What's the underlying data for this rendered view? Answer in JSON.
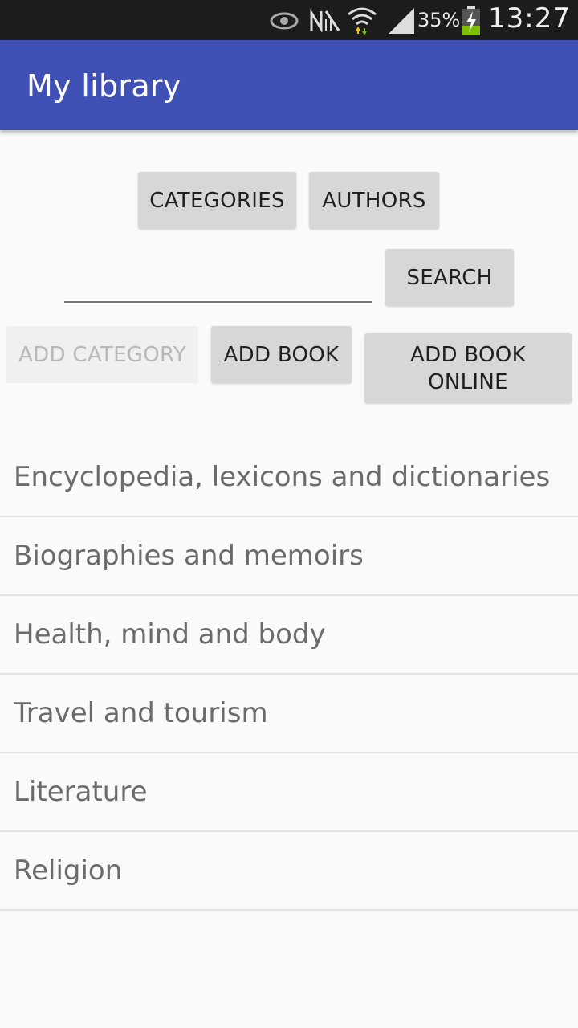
{
  "status_bar": {
    "battery_percent": "35%",
    "time": "13:27",
    "icons": [
      "eye-icon",
      "no-sim-icon",
      "wifi-icon",
      "signal-icon",
      "battery-charging-icon"
    ]
  },
  "app_bar": {
    "title": "My library",
    "color": "#3f51b5"
  },
  "buttons": {
    "categories": "CATEGORIES",
    "authors": "AUTHORS",
    "search": "SEARCH",
    "add_category": "ADD CATEGORY",
    "add_book": "ADD BOOK",
    "add_book_online_line1": "ADD BOOK",
    "add_book_online_line2": "ONLINE"
  },
  "search": {
    "value": ""
  },
  "categories_list": [
    "Encyclopedia, lexicons and dictionaries",
    "Biographies and memoirs",
    "Health, mind and body",
    "Travel and tourism",
    "Literature",
    "Religion"
  ]
}
